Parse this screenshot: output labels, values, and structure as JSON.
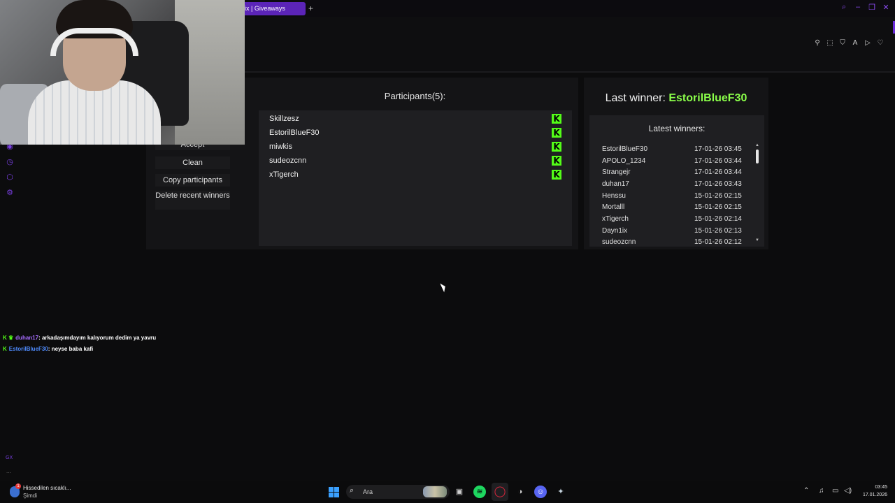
{
  "browser": {
    "tab_title": "Bix | Giveaways",
    "new_tab": "+"
  },
  "giveaway": {
    "buttons": {
      "accept": "Accept",
      "clean": "Clean",
      "copy_participants": "Copy participants",
      "delete_recent_winners": "Delete recent winners"
    },
    "participants_title": "Participants(5):",
    "participants": [
      {
        "name": "Skillzesz",
        "platform_badge": "K"
      },
      {
        "name": "EstorilBlueF30",
        "platform_badge": "K"
      },
      {
        "name": "miwkis",
        "platform_badge": "K"
      },
      {
        "name": "sudeozcnn",
        "platform_badge": "K"
      },
      {
        "name": "xTigerch",
        "platform_badge": "K"
      }
    ],
    "last_winner_label": "Last winner:",
    "last_winner_name": "EstorilBlueF30",
    "latest_winners_title": "Latest winners:",
    "latest_winners": [
      {
        "name": "EstorilBlueF30",
        "date": "17-01-26 03:45"
      },
      {
        "name": "APOLO_1234",
        "date": "17-01-26 03:44"
      },
      {
        "name": "Strangejr",
        "date": "17-01-26 03:44"
      },
      {
        "name": "duhan17",
        "date": "17-01-26 03:43"
      },
      {
        "name": "Henssu",
        "date": "15-01-26 02:15"
      },
      {
        "name": "Mortalll",
        "date": "15-01-26 02:15"
      },
      {
        "name": "xTigerch",
        "date": "15-01-26 02:14"
      },
      {
        "name": "Dayn1ix",
        "date": "15-01-26 02:13"
      },
      {
        "name": "sudeozcnn",
        "date": "15-01-26 02:12"
      }
    ],
    "accent_color": "#53fc18"
  },
  "chat": [
    {
      "user": "duhan17",
      "message": ": arkadaşımdayım kalıyorum dedim ya yavru"
    },
    {
      "user": "EstorilBlueF30",
      "message": ": neyse baba kafi"
    }
  ],
  "sidebar": {
    "bottom_label": "GX",
    "more": "..."
  },
  "taskbar": {
    "weather_badge": "1",
    "weather_text": "Hissedilen sıcaklı...",
    "weather_sub": "Şimdi",
    "search_placeholder": "Ara",
    "time": "03:45",
    "date": "17.01.2026"
  }
}
